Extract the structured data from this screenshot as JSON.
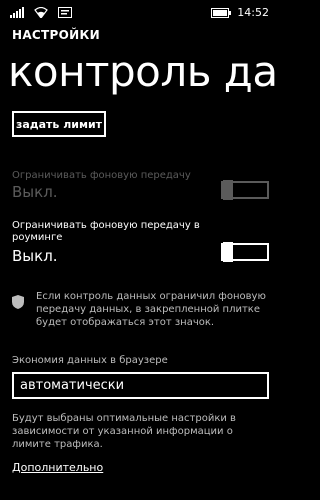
{
  "status_bar": {
    "time": "14:52",
    "icons": [
      "signal-icon",
      "wifi-icon",
      "message-icon",
      "battery-icon"
    ]
  },
  "header": {
    "section": "НАСТРОЙКИ",
    "title": "контроль данных"
  },
  "buttons": {
    "set_limit": "задать лимит"
  },
  "settings": {
    "bg_transfer": {
      "label": "Ограничивать фоновую передачу",
      "value": "Выкл.",
      "enabled": false
    },
    "bg_roaming": {
      "label": "Ограничивать фоновую передачу в роуминге",
      "value": "Выкл.",
      "enabled": true
    }
  },
  "info": {
    "icon": "shield-icon",
    "text": "Если контроль данных ограничил фоновую передачу данных, в закрепленной плитке будет отображаться этот значок."
  },
  "browser_saver": {
    "label": "Экономия данных в браузере",
    "value": "автоматически"
  },
  "description": "Будут выбраны оптимальные настройки в зависимости от указанной информации о лимите трафика.",
  "more_link": "Дополнительно",
  "colors": {
    "background": "#000000",
    "foreground": "#ffffff",
    "disabled": "#5b5b5b"
  }
}
